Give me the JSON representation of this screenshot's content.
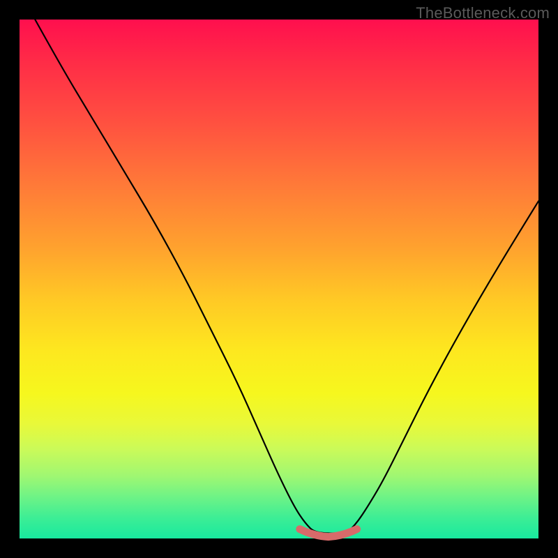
{
  "watermark": "TheBottleneck.com",
  "colors": {
    "frame": "#000000",
    "curve": "#000000",
    "marker": "#d86a6a",
    "gradient_top": "#ff0f4e",
    "gradient_bottom": "#18e99f"
  },
  "chart_data": {
    "type": "line",
    "title": "",
    "xlabel": "",
    "ylabel": "",
    "xlim": [
      0,
      100
    ],
    "ylim": [
      0,
      100
    ],
    "series": [
      {
        "name": "curve",
        "x": [
          3,
          8,
          14,
          20,
          26,
          32,
          37,
          42,
          46,
          50,
          53,
          55,
          57,
          63,
          65,
          67,
          70,
          74,
          79,
          85,
          92,
          100
        ],
        "values": [
          100,
          91,
          81,
          71,
          61,
          50,
          40,
          30,
          21,
          12,
          6,
          3,
          1,
          1,
          3,
          6,
          11,
          19,
          29,
          40,
          52,
          65
        ]
      }
    ],
    "annotations": [
      {
        "name": "trough-marker",
        "x_range": [
          54,
          65
        ],
        "y": 1
      }
    ]
  }
}
